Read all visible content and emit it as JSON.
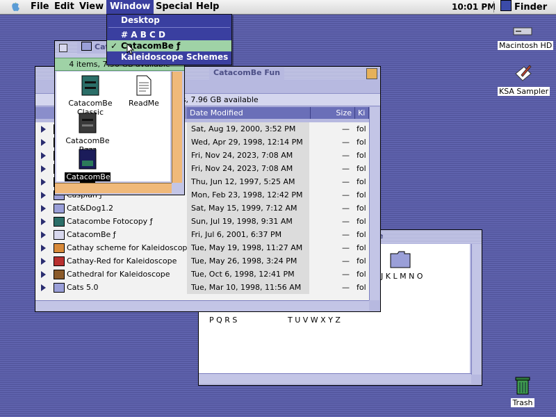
{
  "menubar": {
    "items": [
      "File",
      "Edit",
      "View",
      "Window",
      "Special",
      "Help"
    ],
    "clock": "10:01 PM",
    "app": "Finder"
  },
  "window_menu": {
    "items": [
      {
        "label": "Desktop",
        "checked": false
      },
      {
        "label": "# A B C D",
        "checked": false
      },
      {
        "label": "CatacomBe ƒ",
        "checked": true
      },
      {
        "label": "Kaleidoscope Schemes",
        "checked": false
      }
    ],
    "check_mark": "✓"
  },
  "desktop_icons": {
    "hd": "Macintosh HD",
    "sampler": "KSA Sampler",
    "trash": "Trash"
  },
  "icon_window": {
    "title": "Cata",
    "info": "4 items, 7.96 GB available",
    "items": [
      "CatacomBe Classic",
      "ReadMe",
      "CatacomBe Bzzz",
      "CatacomBe Fun"
    ],
    "selected": "CatacomBe Fun"
  },
  "list_window": {
    "title": "CatacomBe Fun",
    "info": "4 items, 7.96 GB available",
    "columns": {
      "date": "Date Modified",
      "size": "Size",
      "kind": "Ki"
    },
    "rows": [
      {
        "name": "",
        "date": "Sat, Aug 19, 2000, 3:52 PM",
        "size": "—",
        "kind": "fol",
        "icon": "folder"
      },
      {
        "name": "",
        "date": "Wed, Apr 29, 1998, 12:14 PM",
        "size": "—",
        "kind": "fol",
        "icon": "folder"
      },
      {
        "name": "",
        "date": "Fri, Nov 24, 2023, 7:08 AM",
        "size": "—",
        "kind": "fol",
        "icon": "folder"
      },
      {
        "name": "",
        "date": "Fri, Nov 24, 2023, 7:08 AM",
        "size": "—",
        "kind": "fol",
        "icon": "folder"
      },
      {
        "name": "",
        "date": "Thu, Jun 12, 1997, 5:25 AM",
        "size": "—",
        "kind": "fol",
        "icon": "folder"
      },
      {
        "name": "Caspian ƒ",
        "date": "Mon, Feb 23, 1998, 12:42 PM",
        "size": "—",
        "kind": "fol",
        "icon": "folder"
      },
      {
        "name": "Cat&Dog1.2",
        "date": "Sat, May 15, 1999, 7:12 AM",
        "size": "—",
        "kind": "fol",
        "icon": "folder"
      },
      {
        "name": "Catacombe Fotocopy ƒ",
        "date": "Sun, Jul 19, 1998, 9:31 AM",
        "size": "—",
        "kind": "fol",
        "icon": "teal"
      },
      {
        "name": "CatacomBe ƒ",
        "date": "Fri, Jul 6, 2001, 6:37 PM",
        "size": "—",
        "kind": "fol",
        "icon": "grid"
      },
      {
        "name": "Cathay scheme for Kaleidoscope",
        "date": "Tue, May 19, 1998, 11:27 AM",
        "size": "—",
        "kind": "fol",
        "icon": "color"
      },
      {
        "name": "Cathay-Red for Kaleidoscope",
        "date": "Tue, May 26, 1998, 3:24 PM",
        "size": "—",
        "kind": "fol",
        "icon": "red"
      },
      {
        "name": "Cathedral  for Kaleidoscope",
        "date": "Tue, Oct 6, 1998, 12:41 PM",
        "size": "—",
        "kind": "fol",
        "icon": "brown"
      },
      {
        "name": "Cats 5.0",
        "date": "Tue, Mar 10, 1998, 11:56 AM",
        "size": "—",
        "kind": "fol",
        "icon": "folder"
      }
    ]
  },
  "back_window": {
    "title_fragment": "e",
    "labels": [
      "J K L M N O",
      "P Q R S",
      "T U V W X Y Z"
    ]
  },
  "colors": {
    "desktop": "#5b5fa8",
    "menu_highlight": "#3a3fa0",
    "selected_item": "#9fd2a6",
    "window_frame": "#b7b9e0",
    "column_header": "#6a6fb8"
  }
}
